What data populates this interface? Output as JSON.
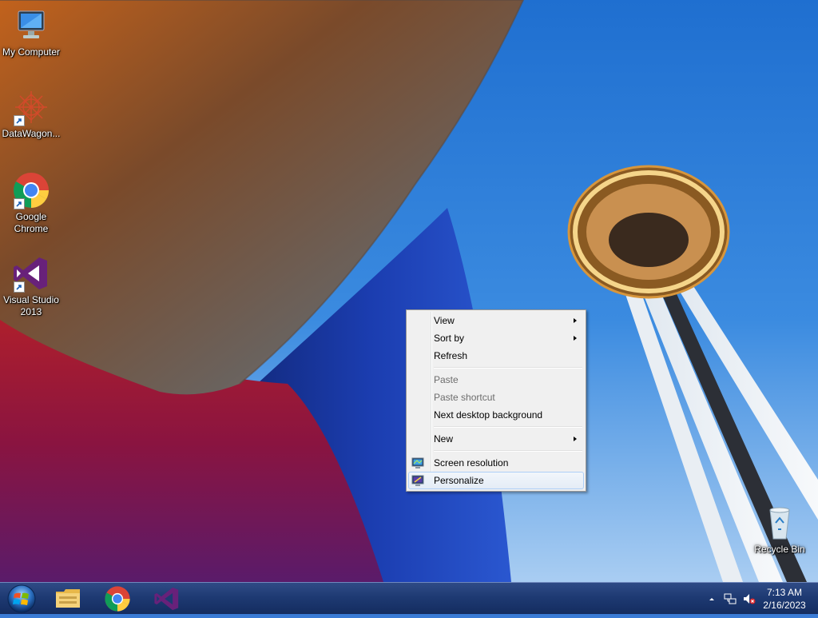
{
  "desktop": {
    "icons": [
      {
        "label": "My Computer",
        "icon": "computer-icon"
      },
      {
        "label": "DataWagon...",
        "icon": "datawagon-icon"
      },
      {
        "label": "Google Chrome",
        "icon": "chrome-icon"
      },
      {
        "label": "Visual Studio 2013",
        "icon": "visual-studio-icon"
      },
      {
        "label": "Recycle Bin",
        "icon": "recycle-bin-icon"
      }
    ]
  },
  "context_menu": {
    "items": [
      {
        "label": "View",
        "submenu": true,
        "enabled": true
      },
      {
        "label": "Sort by",
        "submenu": true,
        "enabled": true
      },
      {
        "label": "Refresh",
        "submenu": false,
        "enabled": true
      },
      {
        "label": "Paste",
        "submenu": false,
        "enabled": false
      },
      {
        "label": "Paste shortcut",
        "submenu": false,
        "enabled": false
      },
      {
        "label": "Next desktop background",
        "submenu": false,
        "enabled": true
      },
      {
        "label": "New",
        "submenu": true,
        "enabled": true
      },
      {
        "label": "Screen resolution",
        "submenu": false,
        "enabled": true,
        "icon": "screen-resolution-icon"
      },
      {
        "label": "Personalize",
        "submenu": false,
        "enabled": true,
        "icon": "personalize-icon",
        "highlighted": true
      }
    ]
  },
  "taskbar": {
    "start_icon": "windows-start-icon",
    "pinned": [
      {
        "name": "file-explorer-icon"
      },
      {
        "name": "chrome-icon"
      },
      {
        "name": "visual-studio-icon"
      }
    ],
    "tray": {
      "icons": [
        "show-hidden-icons-arrow",
        "network-icon",
        "volume-muted-icon"
      ],
      "time": "7:13 AM",
      "date": "2/16/2023"
    }
  },
  "colors": {
    "taskbar": "#1e3a73",
    "menu_background": "#f0f0f0",
    "menu_highlight_border": "#aecff7",
    "sky": "#3a80d2"
  }
}
